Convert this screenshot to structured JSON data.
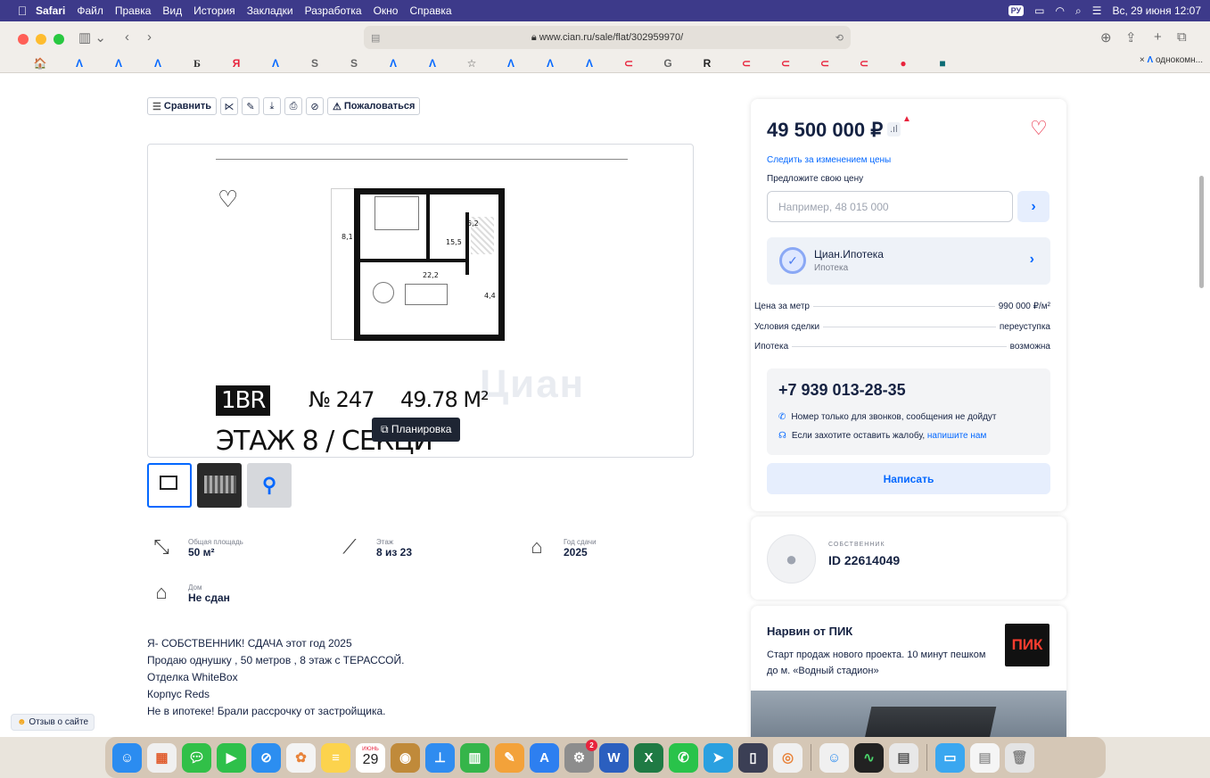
{
  "menubar": {
    "apple": "",
    "app": "Safari",
    "items": [
      "Файл",
      "Правка",
      "Вид",
      "История",
      "Закладки",
      "Разработка",
      "Окно",
      "Справка"
    ],
    "keyboard": "РУ",
    "datetime": "Вс, 29 июня 12:07"
  },
  "browser": {
    "url": "www.cian.ru/sale/flat/302959970/",
    "tab_label": "однокомн...",
    "favorites": [
      "🏠",
      "Λ",
      "Λ",
      "Λ",
      "Б",
      "Я",
      "Λ",
      "S",
      "S",
      "Λ",
      "Λ",
      "☆",
      "Λ",
      "Λ",
      "Λ",
      "⊂",
      "G",
      "R",
      "⊂",
      "⊂",
      "⊂",
      "⊂",
      "●",
      "■"
    ]
  },
  "listing": {
    "actions": {
      "compare": "Сравнить",
      "complain": "Пожаловаться"
    },
    "plan": {
      "dims": [
        "8,1",
        "5,2",
        "15,5",
        "22,2",
        "4,4"
      ],
      "type": "1BR",
      "number": "№ 247",
      "area": "49.78 M²",
      "floor_text": "ЭТАЖ 8 / СЕКЦИ",
      "watermark": "Циан",
      "plan_button": "Планировка"
    },
    "features": [
      {
        "label": "Общая площадь",
        "value": "50 м²"
      },
      {
        "label": "Этаж",
        "value": "8 из 23"
      },
      {
        "label": "Год сдачи",
        "value": "2025"
      },
      {
        "label": "Дом",
        "value": "Не сдан"
      }
    ],
    "description": [
      "Я- СОБСТВЕННИК! СДАЧА этот год 2025",
      "Продаю однушку , 50 метров , 8 этаж с ТЕРАССОЙ.",
      "Отделка WhiteBox",
      "Корпус Reds",
      "Не в ипотеке! Брали рассрочку от застройщика."
    ],
    "feedback": "Отзыв о сайте"
  },
  "sidebar": {
    "price": "49 500 000 ₽",
    "track_price": "Следить за изменением цены",
    "offer_label": "Предложите свою цену",
    "offer_placeholder": "Например, 48 015 000",
    "mortgage_title": "Циан.Ипотека",
    "mortgage_sub": "Ипотека",
    "params": [
      {
        "label": "Цена за метр",
        "value": "990 000 ₽/м²"
      },
      {
        "label": "Условия сделки",
        "value": "переуступка"
      },
      {
        "label": "Ипотека",
        "value": "возможна"
      }
    ],
    "phone": "+7 939 013-28-35",
    "phone_note": "Номер только для звонков, сообщения не дойдут",
    "complain_note": "Если захотите оставить жалобу,",
    "complain_link": "напишите нам",
    "write_button": "Написать",
    "owner_role": "СОБСТВЕННИК",
    "owner_id": "ID 22614049",
    "ad_title": "Нарвин от ПИК",
    "ad_text": "Старт продаж нового проекта. 10 минут пешком до м. «Водный стадион»",
    "ad_logo": "ПИК"
  },
  "dock": {
    "calendar_month": "ИЮНЬ",
    "calendar_day": "29",
    "settings_badge": "2"
  }
}
